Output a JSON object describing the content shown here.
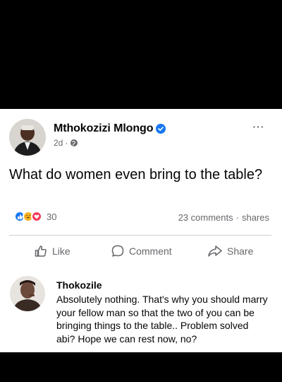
{
  "post": {
    "author": "Mthokozizi Mlongo",
    "time": "2d",
    "separator": "·",
    "more": "···",
    "text": "What do women even bring to the table?"
  },
  "reactions": {
    "icons": [
      "like-icon",
      "haha-icon",
      "love-icon"
    ],
    "count": "30"
  },
  "engagement": {
    "comments": "23 comments",
    "dot": "·",
    "shares": "shares"
  },
  "actions": {
    "like": "Like",
    "comment": "Comment",
    "share": "Share"
  },
  "comment": {
    "author": "Thokozile",
    "text": "Absolutely nothing. That's why you should marry your fellow man so that the two of you can be bringing things to the table.. Problem solved abi? Hope we can rest now, no?"
  },
  "colors": {
    "accent": "#1877f2",
    "muted": "#65676b",
    "haha": "#f7b125",
    "love": "#f33e58"
  }
}
